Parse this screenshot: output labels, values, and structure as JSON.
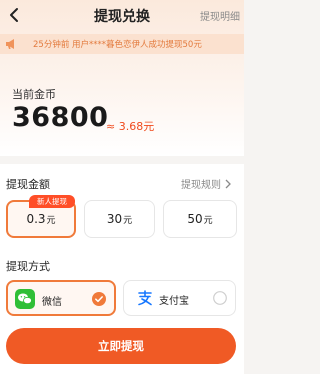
{
  "header": {
    "title": "提现兑换",
    "detail_label": "提现明细"
  },
  "notice": {
    "text": "25分钟前 用户****暮色恋伊人成功提现50元"
  },
  "coins": {
    "label": "当前金币",
    "amount": "36800",
    "approx": "≈ 3.68元"
  },
  "amount_section": {
    "title": "提现金额",
    "rule_label": "提现规则",
    "new_tag": "新人提现",
    "options": [
      {
        "value": "0.3",
        "unit": "元",
        "selected": true
      },
      {
        "value": "30",
        "unit": "元",
        "selected": false
      },
      {
        "value": "50",
        "unit": "元",
        "selected": false
      }
    ]
  },
  "method_section": {
    "title": "提现方式",
    "methods": [
      {
        "label": "微信",
        "icon": "wechat-icon",
        "selected": true
      },
      {
        "label": "支付宝",
        "icon": "alipay-icon",
        "selected": false
      }
    ]
  },
  "submit": {
    "label": "立即提现"
  },
  "colors": {
    "accent": "#f05a25",
    "notice_text": "#e37a3d",
    "wechat": "#2fbf37",
    "alipay": "#1677ff"
  }
}
